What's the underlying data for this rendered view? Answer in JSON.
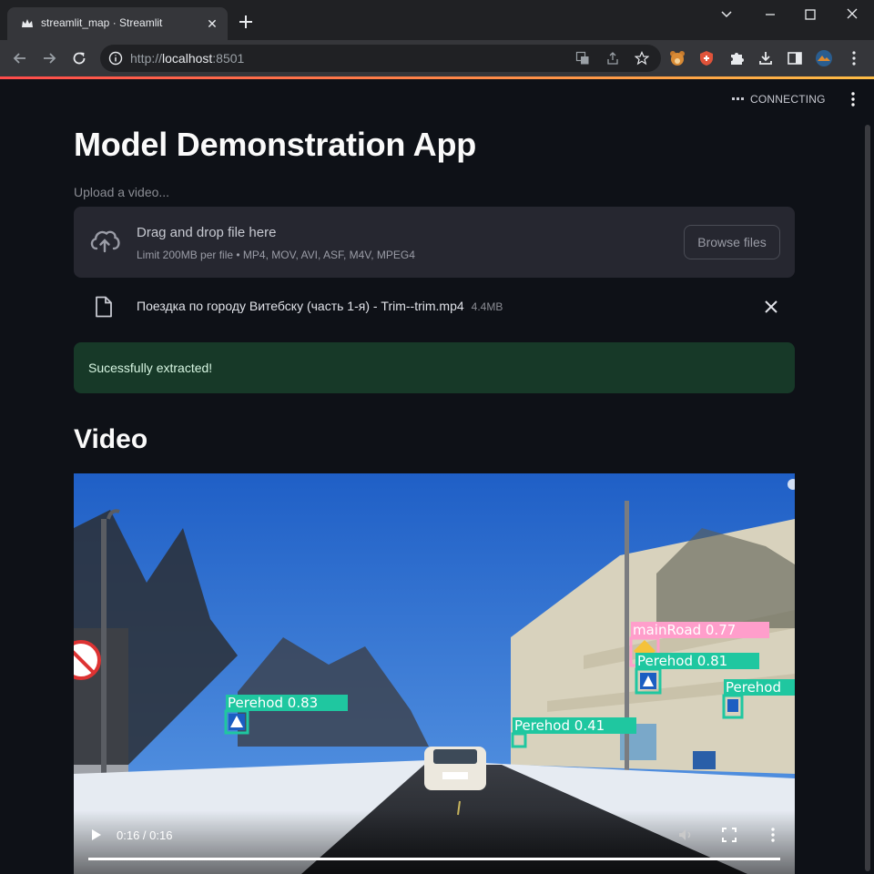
{
  "browser": {
    "tab_title": "streamlit_map · Streamlit",
    "url_prefix": "http://",
    "url_host": "localhost",
    "url_port": ":8501"
  },
  "app": {
    "status": "CONNECTING",
    "title": "Model Demonstration App",
    "uploader": {
      "label": "Upload a video...",
      "drop_text": "Drag and drop file here",
      "limit_text": "Limit 200MB per file • MP4, MOV, AVI, ASF, M4V, MPEG4",
      "browse_label": "Browse files"
    },
    "file": {
      "name": "Поездка по городу Витебску (часть 1-я) - Trim--trim.mp4",
      "size": "4.4MB"
    },
    "success_message": "Sucessfully extracted!",
    "video_heading": "Video",
    "video": {
      "current_time": "0:16 / 0:16",
      "progress": 1.0,
      "detections": [
        {
          "label": "mainRoad 0.77",
          "color": "#ff9ecb"
        },
        {
          "label": "Perehod 0.81",
          "color": "#1fc7a0"
        },
        {
          "label": "Perehod",
          "color": "#1fc7a0"
        },
        {
          "label": "Perehod 0.83",
          "color": "#1fc7a0"
        },
        {
          "label": "Perehod 0.41",
          "color": "#1fc7a0"
        }
      ]
    }
  },
  "colors": {
    "accent_start": "#ff4b4b",
    "accent_end": "#ffbd45",
    "success_bg": "#173928",
    "app_bg": "#0e1117"
  }
}
